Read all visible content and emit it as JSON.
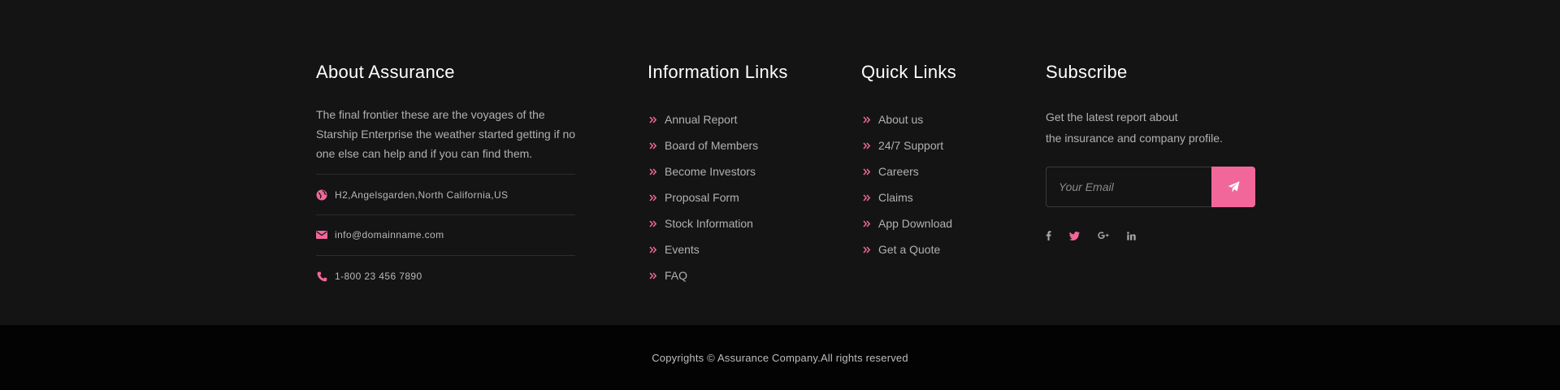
{
  "about": {
    "title": "About Assurance",
    "text": "The final frontier these are the voyages of the Starship Enterprise the weather started getting if no one else can help and if you can find them.",
    "address": "H2,Angelsgarden,North California,US",
    "email": "info@domainname.com",
    "phone": "1-800 23 456 7890",
    "icons": [
      "globe-icon",
      "envelope-icon",
      "phone-icon"
    ]
  },
  "information_links": {
    "title": "Information Links",
    "items": [
      "Annual Report",
      "Board of Members",
      "Become Investors",
      "Proposal Form",
      "Stock Information",
      "Events",
      "FAQ"
    ]
  },
  "quick_links": {
    "title": "Quick Links",
    "items": [
      "About us",
      "24/7 Support",
      "Careers",
      "Claims",
      "App Download",
      "Get a Quote"
    ]
  },
  "subscribe": {
    "title": "Subscribe",
    "line1": "Get the latest report about",
    "line2": "the insurance and company profile.",
    "email_placeholder": "Your Email",
    "email_value": "",
    "button_icon": "paper-plane-icon",
    "socials": [
      {
        "name": "facebook-icon",
        "glyph": "f"
      },
      {
        "name": "twitter-icon",
        "glyph": ""
      },
      {
        "name": "google-plus-icon",
        "glyph": "g+"
      },
      {
        "name": "linkedin-icon",
        "glyph": "in"
      }
    ]
  },
  "footer_bar": {
    "copyright": "Copyrights © Assurance Company.All rights reserved"
  },
  "colors": {
    "background": "#141415",
    "bottom_bar": "#030303",
    "accent": "#f2679a",
    "heading": "#ffffff",
    "text": "#b1b1b1"
  }
}
